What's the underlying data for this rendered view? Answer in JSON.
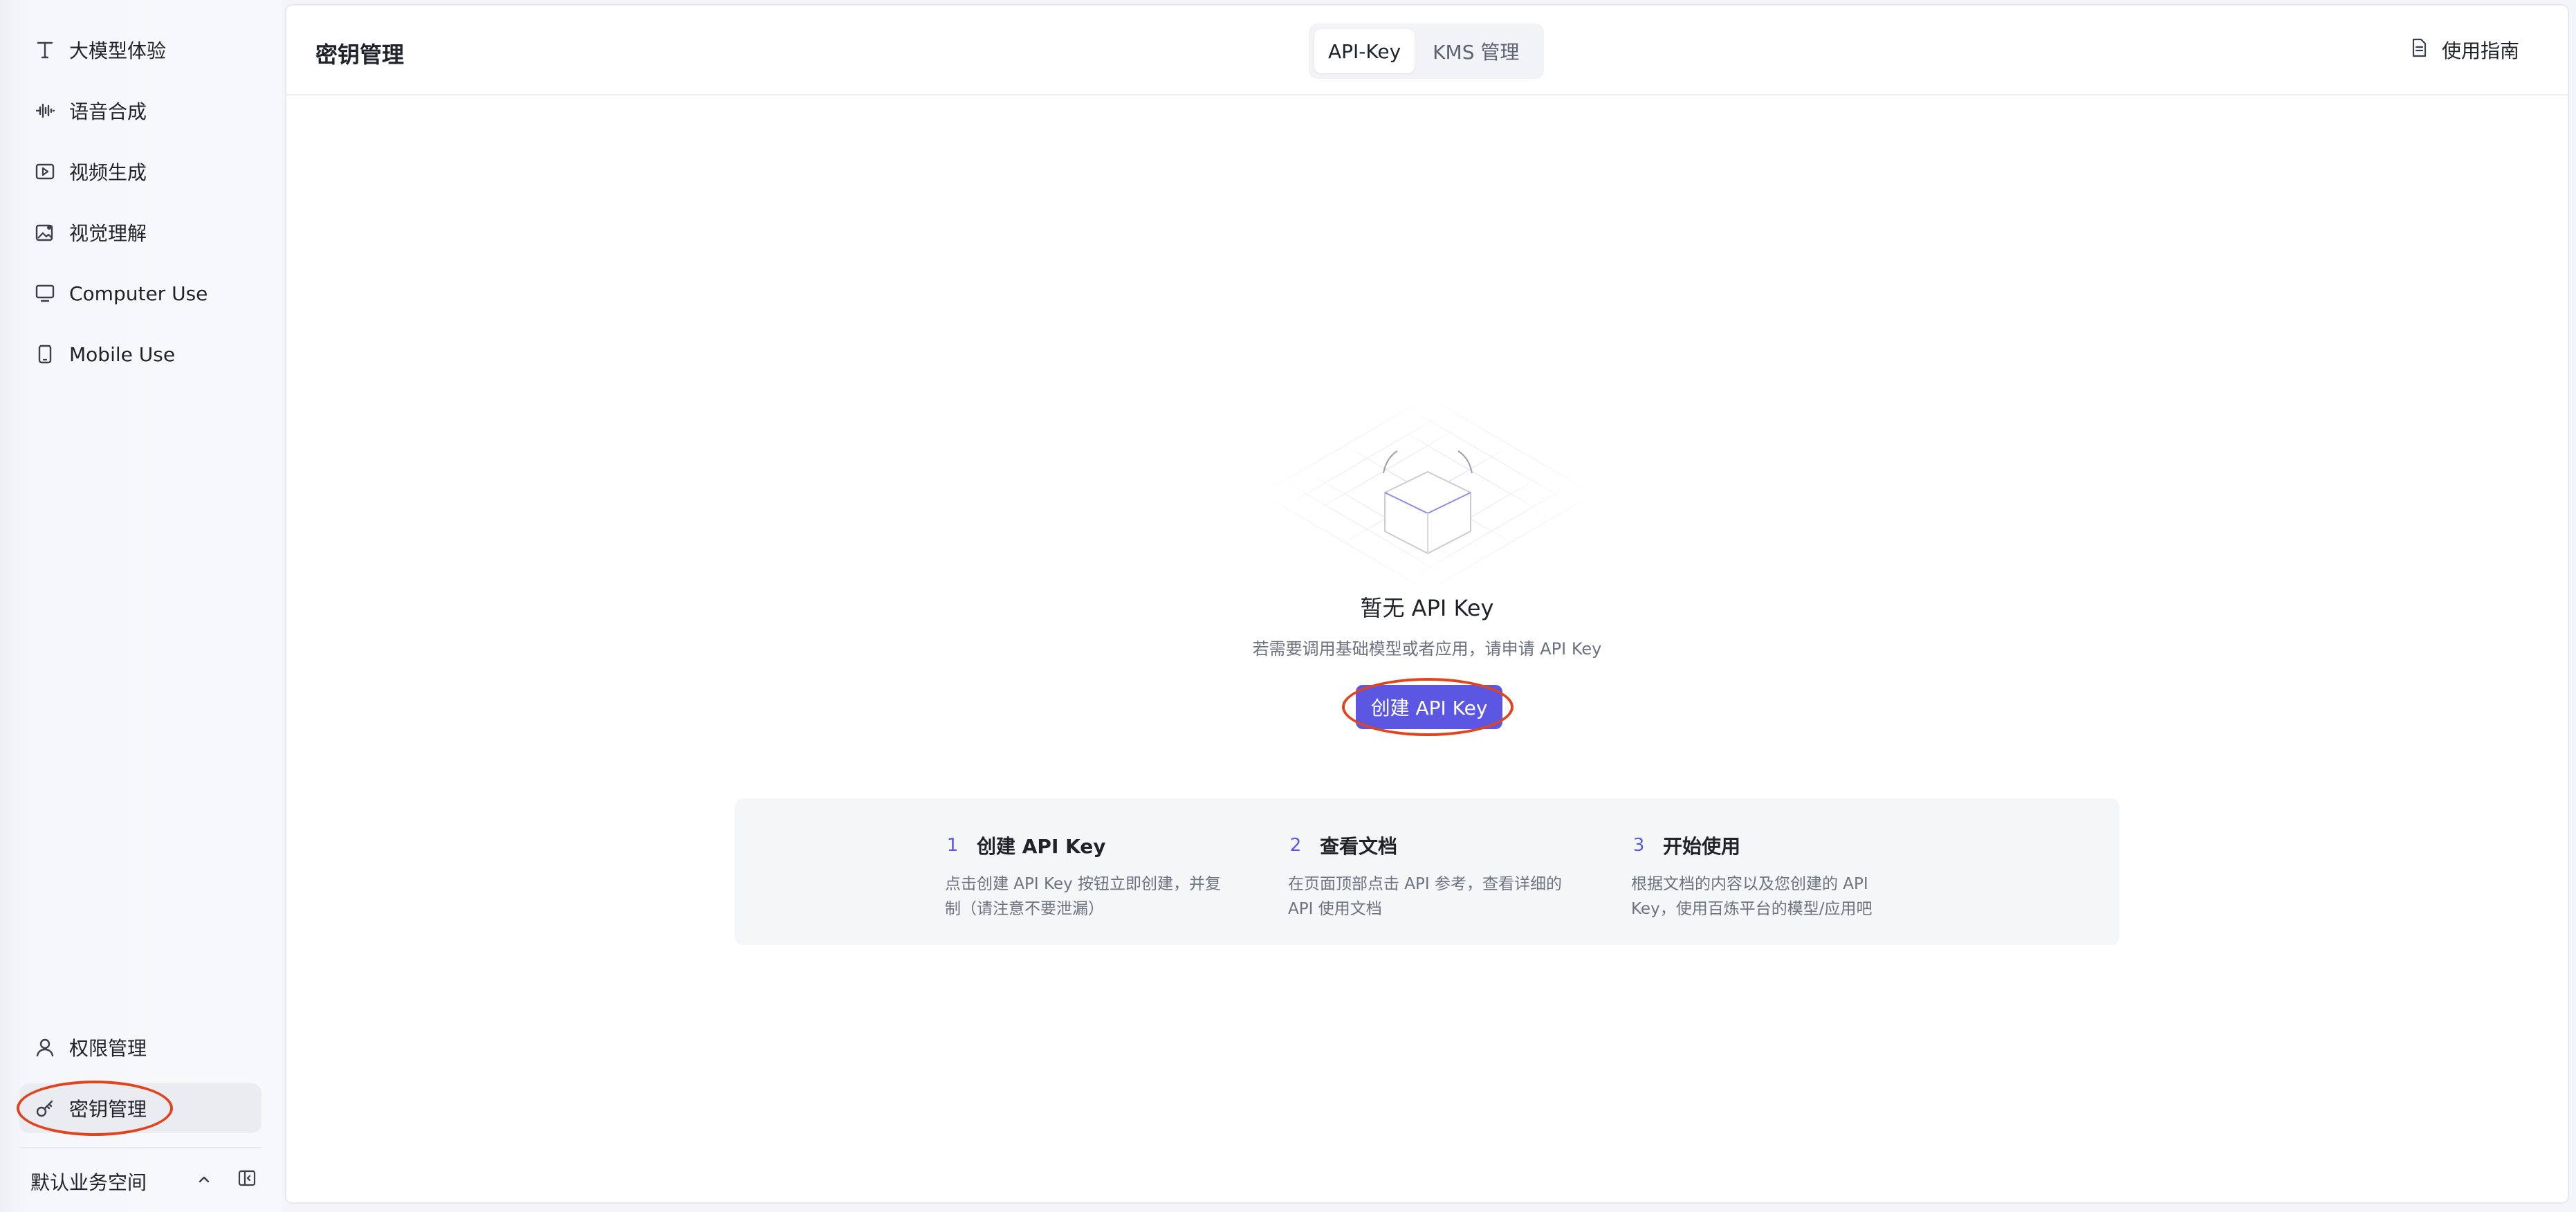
{
  "sidebar": {
    "items": [
      {
        "label": "大模型体验",
        "icon": "text-icon"
      },
      {
        "label": "语音合成",
        "icon": "waveform-icon"
      },
      {
        "label": "视频生成",
        "icon": "video-icon"
      },
      {
        "label": "视觉理解",
        "icon": "image-icon"
      },
      {
        "label": "Computer Use",
        "icon": "monitor-icon"
      },
      {
        "label": "Mobile Use",
        "icon": "mobile-icon"
      }
    ],
    "bottom_items": [
      {
        "label": "权限管理",
        "icon": "user-icon"
      },
      {
        "label": "密钥管理",
        "icon": "key-icon",
        "active": true
      }
    ],
    "workspace": "默认业务空间"
  },
  "header": {
    "title": "密钥管理",
    "tabs": [
      {
        "label": "API-Key",
        "active": true
      },
      {
        "label": "KMS 管理",
        "active": false
      }
    ],
    "guide_label": "使用指南"
  },
  "empty_state": {
    "title": "暂无 API Key",
    "description": "若需要调用基础模型或者应用，请申请 API Key",
    "button_label": "创建 API Key"
  },
  "steps": [
    {
      "num": "1",
      "title": "创建 API Key",
      "desc": "点击创建 API Key 按钮立即创建，并复制（请注意不要泄漏）"
    },
    {
      "num": "2",
      "title": "查看文档",
      "desc": "在页面顶部点击 API 参考，查看详细的 API 使用文档"
    },
    {
      "num": "3",
      "title": "开始使用",
      "desc": "根据文档的内容以及您创建的 API Key，使用百炼平台的模型/应用吧"
    }
  ],
  "colors": {
    "accent": "#5b57e3",
    "annotation": "#e0441f"
  }
}
